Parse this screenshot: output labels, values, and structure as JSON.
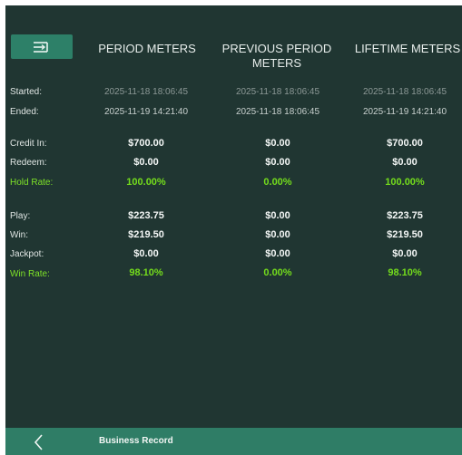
{
  "header": {
    "period": "PERIOD METERS",
    "previous": "PREVIOUS PERIOD METERS",
    "lifetime": "LIFETIME METERS"
  },
  "labels": {
    "started": "Started:",
    "ended": "Ended:",
    "credit_in": "Credit In:",
    "redeem": "Redeem:",
    "hold_rate": "Hold Rate:",
    "play": "Play:",
    "win": "Win:",
    "jackpot": "Jackpot:",
    "win_rate": "Win Rate:"
  },
  "period": {
    "started": "2025-11-18 18:06:45",
    "ended": "2025-11-19 14:21:40",
    "credit_in": "$700.00",
    "redeem": "$0.00",
    "hold_rate": "100.00%",
    "play": "$223.75",
    "win": "$219.50",
    "jackpot": "$0.00",
    "win_rate": "98.10%"
  },
  "previous": {
    "started": "2025-11-18 18:06:45",
    "ended": "2025-11-18 18:06:45",
    "credit_in": "$0.00",
    "redeem": "$0.00",
    "hold_rate": "0.00%",
    "play": "$0.00",
    "win": "$0.00",
    "jackpot": "$0.00",
    "win_rate": "0.00%"
  },
  "lifetime": {
    "started": "2025-11-18 18:06:45",
    "ended": "2025-11-19 14:21:40",
    "credit_in": "$700.00",
    "redeem": "$0.00",
    "hold_rate": "100.00%",
    "play": "$223.75",
    "win": "$219.50",
    "jackpot": "$0.00",
    "win_rate": "98.10%"
  },
  "footer": {
    "title": "Business Record"
  },
  "colors": {
    "background": "#203632",
    "accent": "#2f7d66",
    "highlight": "#74dd1c"
  },
  "icons": {
    "menu": "menu-collapse-icon",
    "back": "chevron-left-icon"
  }
}
